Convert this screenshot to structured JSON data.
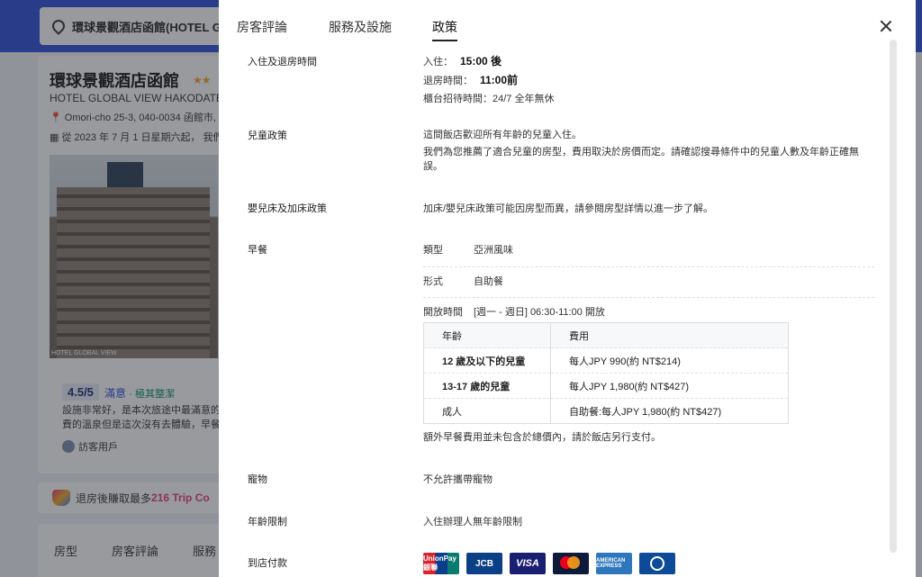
{
  "background": {
    "search_text": "環球景觀酒店函館(HOTEL GL",
    "hotel_name": "環球景觀酒店函館",
    "stars": "★★",
    "hotel_name_en": "HOTEL GLOBAL VIEW HAKODATE",
    "address": "Omori-cho 25-3, 040-0034 函館市, ",
    "since": "從 2023 年 7 月 1 日星期六起， 我們",
    "photo_caption": "HOTEL GLOBAL VIEW",
    "rating_score": "4.5/5",
    "rating_label": "滿意",
    "rating_badge": "· 極其整潔",
    "review_text": "設施非常好，是本次旅途中最滿意的，費的溫泉但是這次沒有去體驗，早餐",
    "reviewer": "訪客用戶",
    "banner_text_pre": "退房後賺取最多",
    "banner_text_highlight": "216 Trip Co",
    "tabs": [
      "房型",
      "房客評論",
      "服務"
    ]
  },
  "modal": {
    "tabs": [
      "房客評論",
      "服務及設施",
      "政策"
    ],
    "active_tab": "政策"
  },
  "policy": {
    "checkin": {
      "label": "入住及退房時間",
      "in_label": "入住：",
      "in_value": "15:00 後",
      "out_label": "退房時間：",
      "out_value": "11:00前",
      "desk": "櫃台招待時間：24/7 全年無休"
    },
    "children": {
      "label": "兒童政策",
      "line1": "這間飯店歡迎所有年齡的兒童入住。",
      "line2": "我們為您推薦了適合兒童的房型，費用取決於房價而定。請確認搜尋條件中的兒童人數及年齡正確無誤。"
    },
    "cribs": {
      "label": "嬰兒床及加床政策",
      "text": "加床/嬰兒床政策可能因房型而異，請參閱房型詳情以進一步了解。"
    },
    "breakfast": {
      "label": "早餐",
      "type_label": "類型",
      "type_value": "亞洲風味",
      "style_label": "形式",
      "style_value": "自助餐",
      "hours_label": "開放時間",
      "hours_value": "[週一 - 週日] 06:30-11:00 開放",
      "table_headers": [
        "年齡",
        "費用"
      ],
      "table_rows": [
        [
          "12 歲及以下的兒童",
          "每人JPY 990(約 NT$214)"
        ],
        [
          "13-17 歲的兒童",
          "每人JPY 1,980(約 NT$427)"
        ],
        [
          "成人",
          "自助餐:每人JPY 1,980(約 NT$427)"
        ]
      ],
      "note": "額外早餐費用並未包含於總價內，請於飯店另行支付。"
    },
    "pets": {
      "label": "寵物",
      "text": "不允許攜帶寵物"
    },
    "age": {
      "label": "年齡限制",
      "text": "入住辦理人無年齡限制"
    },
    "payment": {
      "label": "到店付款",
      "cards": [
        "UnionPay 銀聯",
        "JCB",
        "VISA",
        "mastercard",
        "AMERICAN EXPRESS",
        "Diners Club"
      ]
    }
  }
}
